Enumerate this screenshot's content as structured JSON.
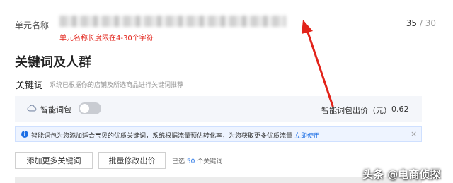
{
  "unit": {
    "label": "单元名称",
    "count_current": "35",
    "count_sep": " / ",
    "count_max": "30",
    "error": "单元名称长度限在4-30个字符"
  },
  "section": {
    "title": "关键词及人群",
    "keyword_label": "关键词",
    "keyword_hint": "系统已根据你的店铺及所选商品进行关键词推荐"
  },
  "smart_package": {
    "label": "智能词包",
    "enabled": false,
    "bid_label": "智能词包出价（元）",
    "bid_value": "0.62"
  },
  "info_banner": {
    "text": "智能词包为您添加适合宝贝的优质关键词，系统根据流量预估转化率，为您获取更多优质流量",
    "link": "立即使用"
  },
  "actions": {
    "add_keywords": "添加更多关键词",
    "batch_bid": "批量修改出价",
    "selected_prefix": "已选 ",
    "selected_count": "50",
    "selected_suffix": " 个关键词"
  },
  "watermark": "头条 @电商侦探",
  "colors": {
    "error": "#e2231a",
    "accent": "#1d6fe5"
  }
}
